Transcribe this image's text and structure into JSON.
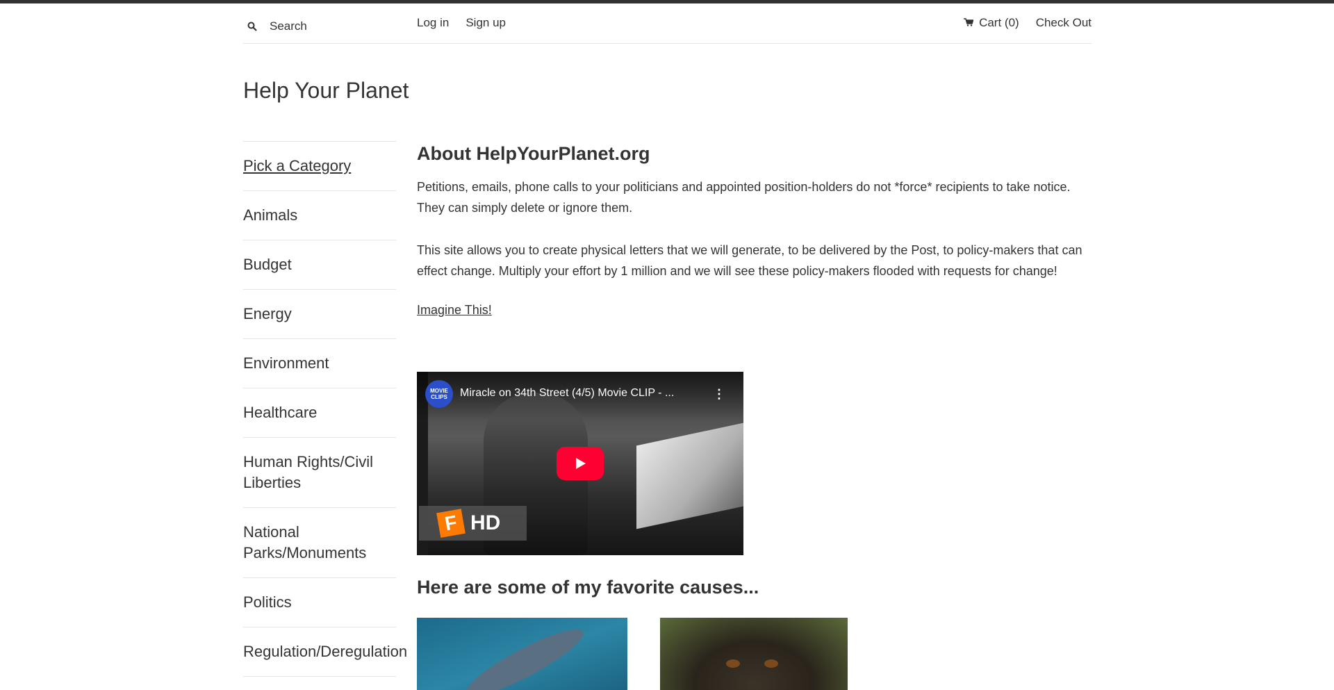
{
  "header": {
    "search_placeholder": "Search",
    "login_label": "Log in",
    "signup_label": "Sign up",
    "cart_label": "Cart (0)",
    "checkout_label": "Check Out"
  },
  "site": {
    "title": "Help Your Planet"
  },
  "sidebar": {
    "heading": "Pick a Category",
    "items": [
      "Animals",
      "Budget",
      "Energy",
      "Environment",
      "Healthcare",
      "Human Rights/Civil Liberties",
      "National Parks/Monuments",
      "Politics",
      "Regulation/Deregulation"
    ]
  },
  "main": {
    "about_title": "About HelpYourPlanet.org",
    "paragraph_1": "Petitions, emails, phone calls to your politicians and appointed position-holders do not *force* recipients to take notice. They can simply delete or ignore them.",
    "paragraph_2": "This site allows you to create physical letters that we will generate, to be delivered by the Post, to policy-makers that can effect change. Multiply your effort by 1 million and we will see these policy-makers flooded with requests for change!",
    "imagine_link": "Imagine This!",
    "video": {
      "channel_logo_text": "MOVIE CLIPS",
      "title": "Miracle on 34th Street (4/5) Movie CLIP - ...",
      "badge_letter": "F",
      "badge_text": "HD"
    },
    "causes_title": "Here are some of my favorite causes..."
  },
  "colors": {
    "text": "#333333",
    "topbar": "#333333",
    "divider": "#e5e5e5",
    "play_button": "#ff0033"
  }
}
